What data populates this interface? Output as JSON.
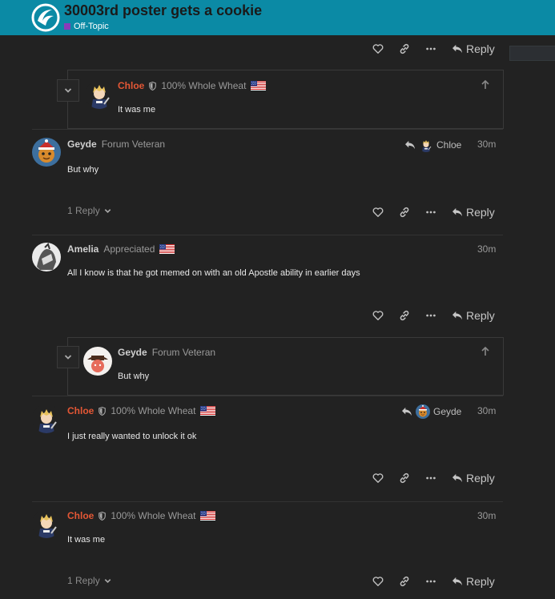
{
  "header": {
    "topic_title": "30003rd poster gets a cookie",
    "category": "Off-Topic",
    "category_color": "#8a3ab9",
    "accent": "#0b8aa5"
  },
  "actions": {
    "reply_label": "Reply",
    "icons": [
      "heart-icon",
      "link-icon",
      "ellipsis-icon",
      "reply-arrow-icon"
    ]
  },
  "posts": [
    {
      "embedded": {
        "name": "Chloe",
        "title": "100% Whole Wheat",
        "text": "It was me"
      }
    },
    {
      "name": "Geyde",
      "title": "Forum Veteran",
      "reply_to": "Chloe",
      "time": "30m",
      "text": "But why",
      "replies": "1 Reply"
    },
    {
      "name": "Amelia",
      "title": "Appreciated",
      "time": "30m",
      "text": "All I know is that he got memed on with an old Apostle ability in earlier days",
      "embedded": {
        "name": "Geyde",
        "title": "Forum Veteran",
        "text": "But why"
      }
    },
    {
      "name": "Chloe",
      "title": "100% Whole Wheat",
      "reply_to": "Geyde",
      "time": "30m",
      "text": "I just really wanted to unlock it ok"
    },
    {
      "name": "Chloe",
      "title": "100% Whole Wheat",
      "time": "30m",
      "text": "It was me",
      "replies": "1 Reply"
    }
  ]
}
